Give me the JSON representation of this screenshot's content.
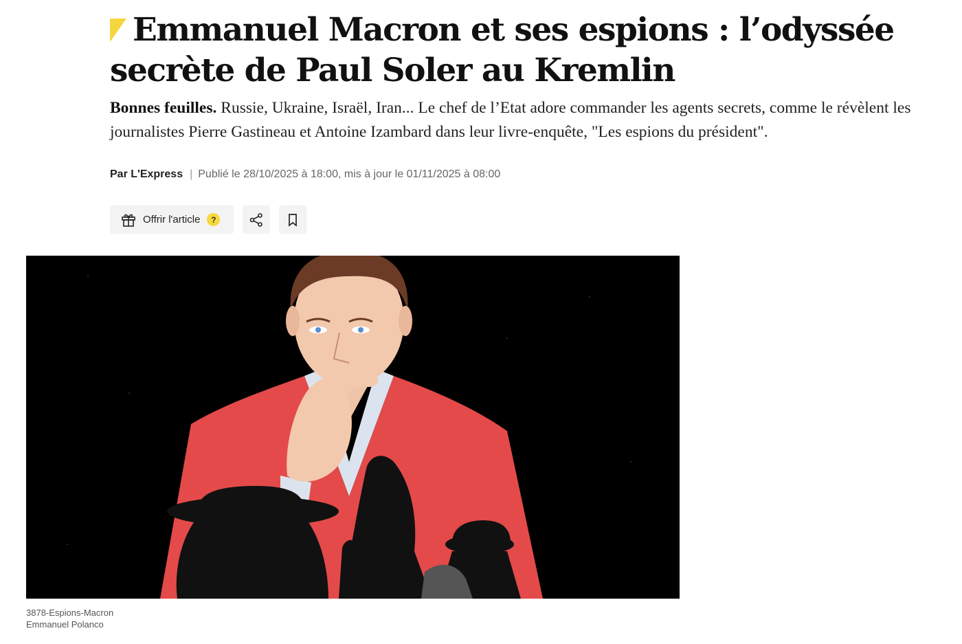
{
  "article": {
    "title": "Emmanuel Macron et ses espions : l’odyssée secrète de Paul Soler au Kremlin",
    "standfirst_lead": "Bonnes feuilles.",
    "standfirst_text": " Russie, Ukraine, Israël, Iran... Le chef de l’Etat adore commander les agents secrets, comme le révèlent les journalistes Pierre Gastineau et Antoine Izambard dans leur livre-enquête, \"Les espions du président\".",
    "byline_author": "Par L'Express",
    "byline_sep": "|",
    "byline_dates": "Publié le 28/10/2025 à 18:00, mis à jour le 01/11/2025 à 08:00"
  },
  "actions": {
    "offer_label": "Offrir l'article",
    "offer_help": "?",
    "offer_icon": "gift-icon",
    "share_icon": "share-icon",
    "save_icon": "bookmark-icon"
  },
  "image": {
    "caption_title": "3878-Espions-Macron",
    "caption_credit": "Emmanuel Polanco"
  },
  "colors": {
    "accent_flag": "#f5d63d",
    "jacket_red": "#e44a4a",
    "background_black": "#000000"
  }
}
